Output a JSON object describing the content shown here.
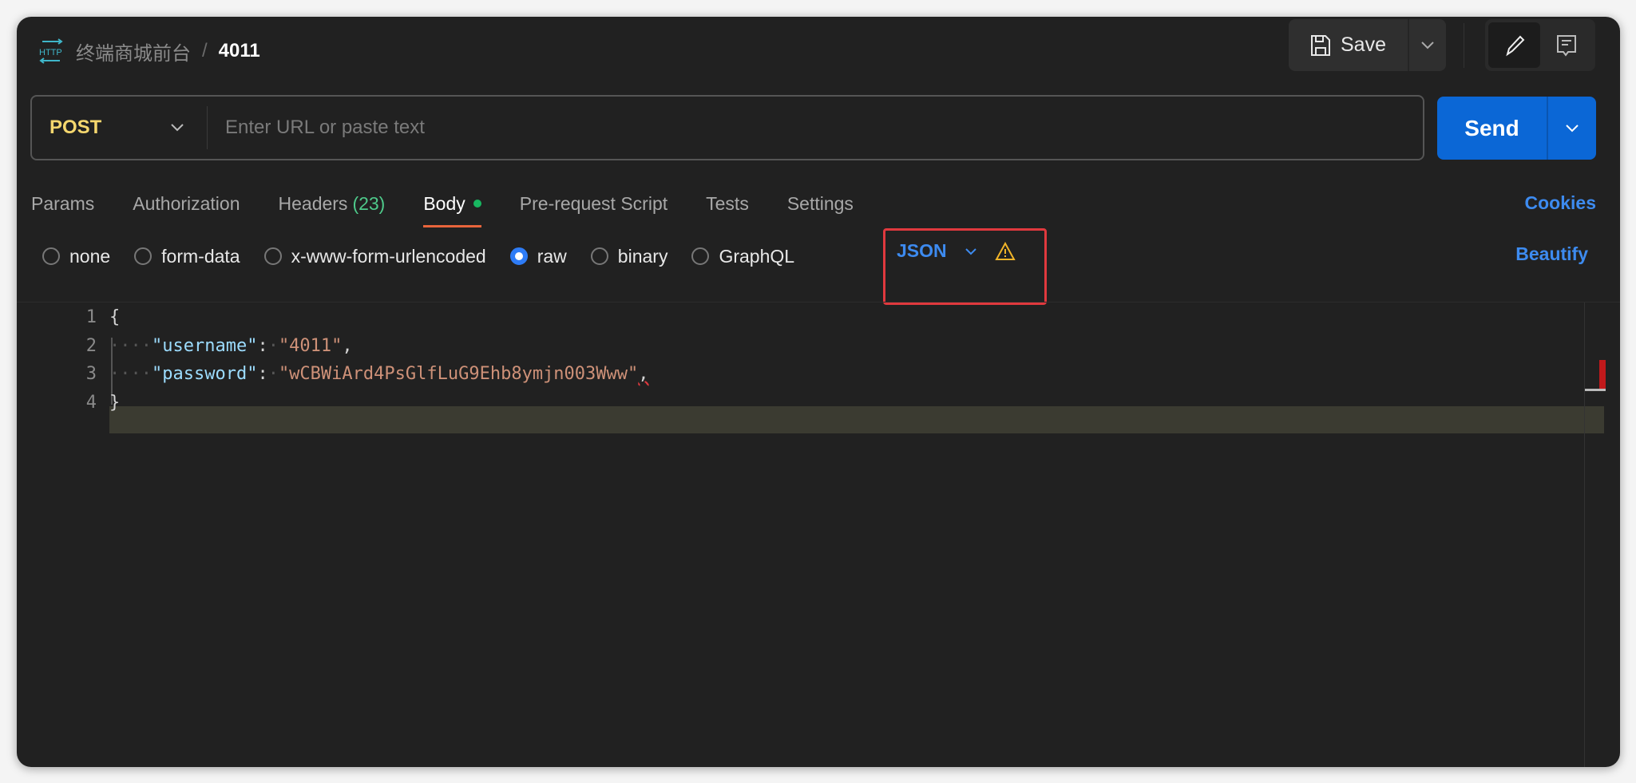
{
  "header": {
    "crumb": "终端商城前台",
    "separator": "/",
    "name": "4011",
    "save_label": "Save"
  },
  "request": {
    "method": "POST",
    "url_value": "",
    "url_placeholder": "Enter URL or paste text",
    "send_label": "Send"
  },
  "tabs": [
    {
      "label": "Params"
    },
    {
      "label": "Authorization"
    },
    {
      "label": "Headers",
      "count": "(23)"
    },
    {
      "label": "Body",
      "active": true
    },
    {
      "label": "Pre-request Script"
    },
    {
      "label": "Tests"
    },
    {
      "label": "Settings"
    }
  ],
  "cookies_label": "Cookies",
  "body_types": [
    {
      "label": "none"
    },
    {
      "label": "form-data"
    },
    {
      "label": "x-www-form-urlencoded"
    },
    {
      "label": "raw",
      "selected": true
    },
    {
      "label": "binary"
    },
    {
      "label": "GraphQL"
    }
  ],
  "raw_format": "JSON",
  "beautify_label": "Beautify",
  "editor": {
    "line_numbers": [
      "1",
      "2",
      "3",
      "4"
    ],
    "open": "{",
    "close": "}",
    "k1": "\"username\"",
    "v1": "\"4011\"",
    "k2": "\"password\"",
    "v2": "\"wCBWiArd4PsGlfLuG9Ehb8ymjn003Www\"",
    "colon": ":",
    "comma": ","
  },
  "colors": {
    "accent": "#0b67d6",
    "method": "#f5d76e",
    "active_tab": "#e8643b",
    "highlight_box": "#e0393e",
    "warning": "#f0b429"
  }
}
